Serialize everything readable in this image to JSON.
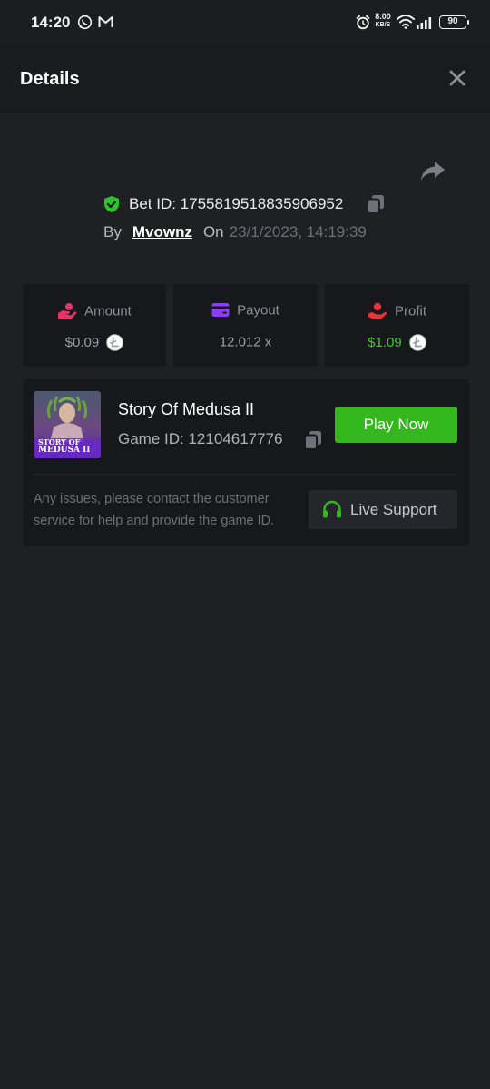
{
  "status_bar": {
    "time": "14:20",
    "speed_value": "8.00",
    "speed_unit": "KB/S",
    "battery": "90"
  },
  "header": {
    "title": "Details",
    "close_icon": "close-icon"
  },
  "bet": {
    "id_label": "Bet ID: 1755819518835906952",
    "by_label": "By",
    "user": "Mvownz",
    "on_label": "On",
    "date": "23/1/2023, 14:19:39"
  },
  "stats": {
    "amount": {
      "label": "Amount",
      "value": "$0.09",
      "icon": "bet-hand-icon",
      "icon_color": "#e8336b"
    },
    "payout": {
      "label": "Payout",
      "value": "12.012 x",
      "icon": "card-icon",
      "icon_color": "#8a3ff0"
    },
    "profit": {
      "label": "Profit",
      "value": "$1.09",
      "icon": "profit-hand-icon",
      "icon_color": "#e8333b",
      "value_color": "#43c72b"
    }
  },
  "game": {
    "name": "Story Of Medusa II",
    "id_label": "Game ID: 12104617776",
    "play_label": "Play Now",
    "thumbnail_title_line1": "STORY OF",
    "thumbnail_title_line2": "MEDUSA II",
    "help_text": "Any issues, please contact the customer service for help and provide the game ID.",
    "support_label": "Live Support"
  },
  "colors": {
    "accent_green": "#35b71e",
    "shield_green": "#2fc22a",
    "background": "#1f2024"
  }
}
